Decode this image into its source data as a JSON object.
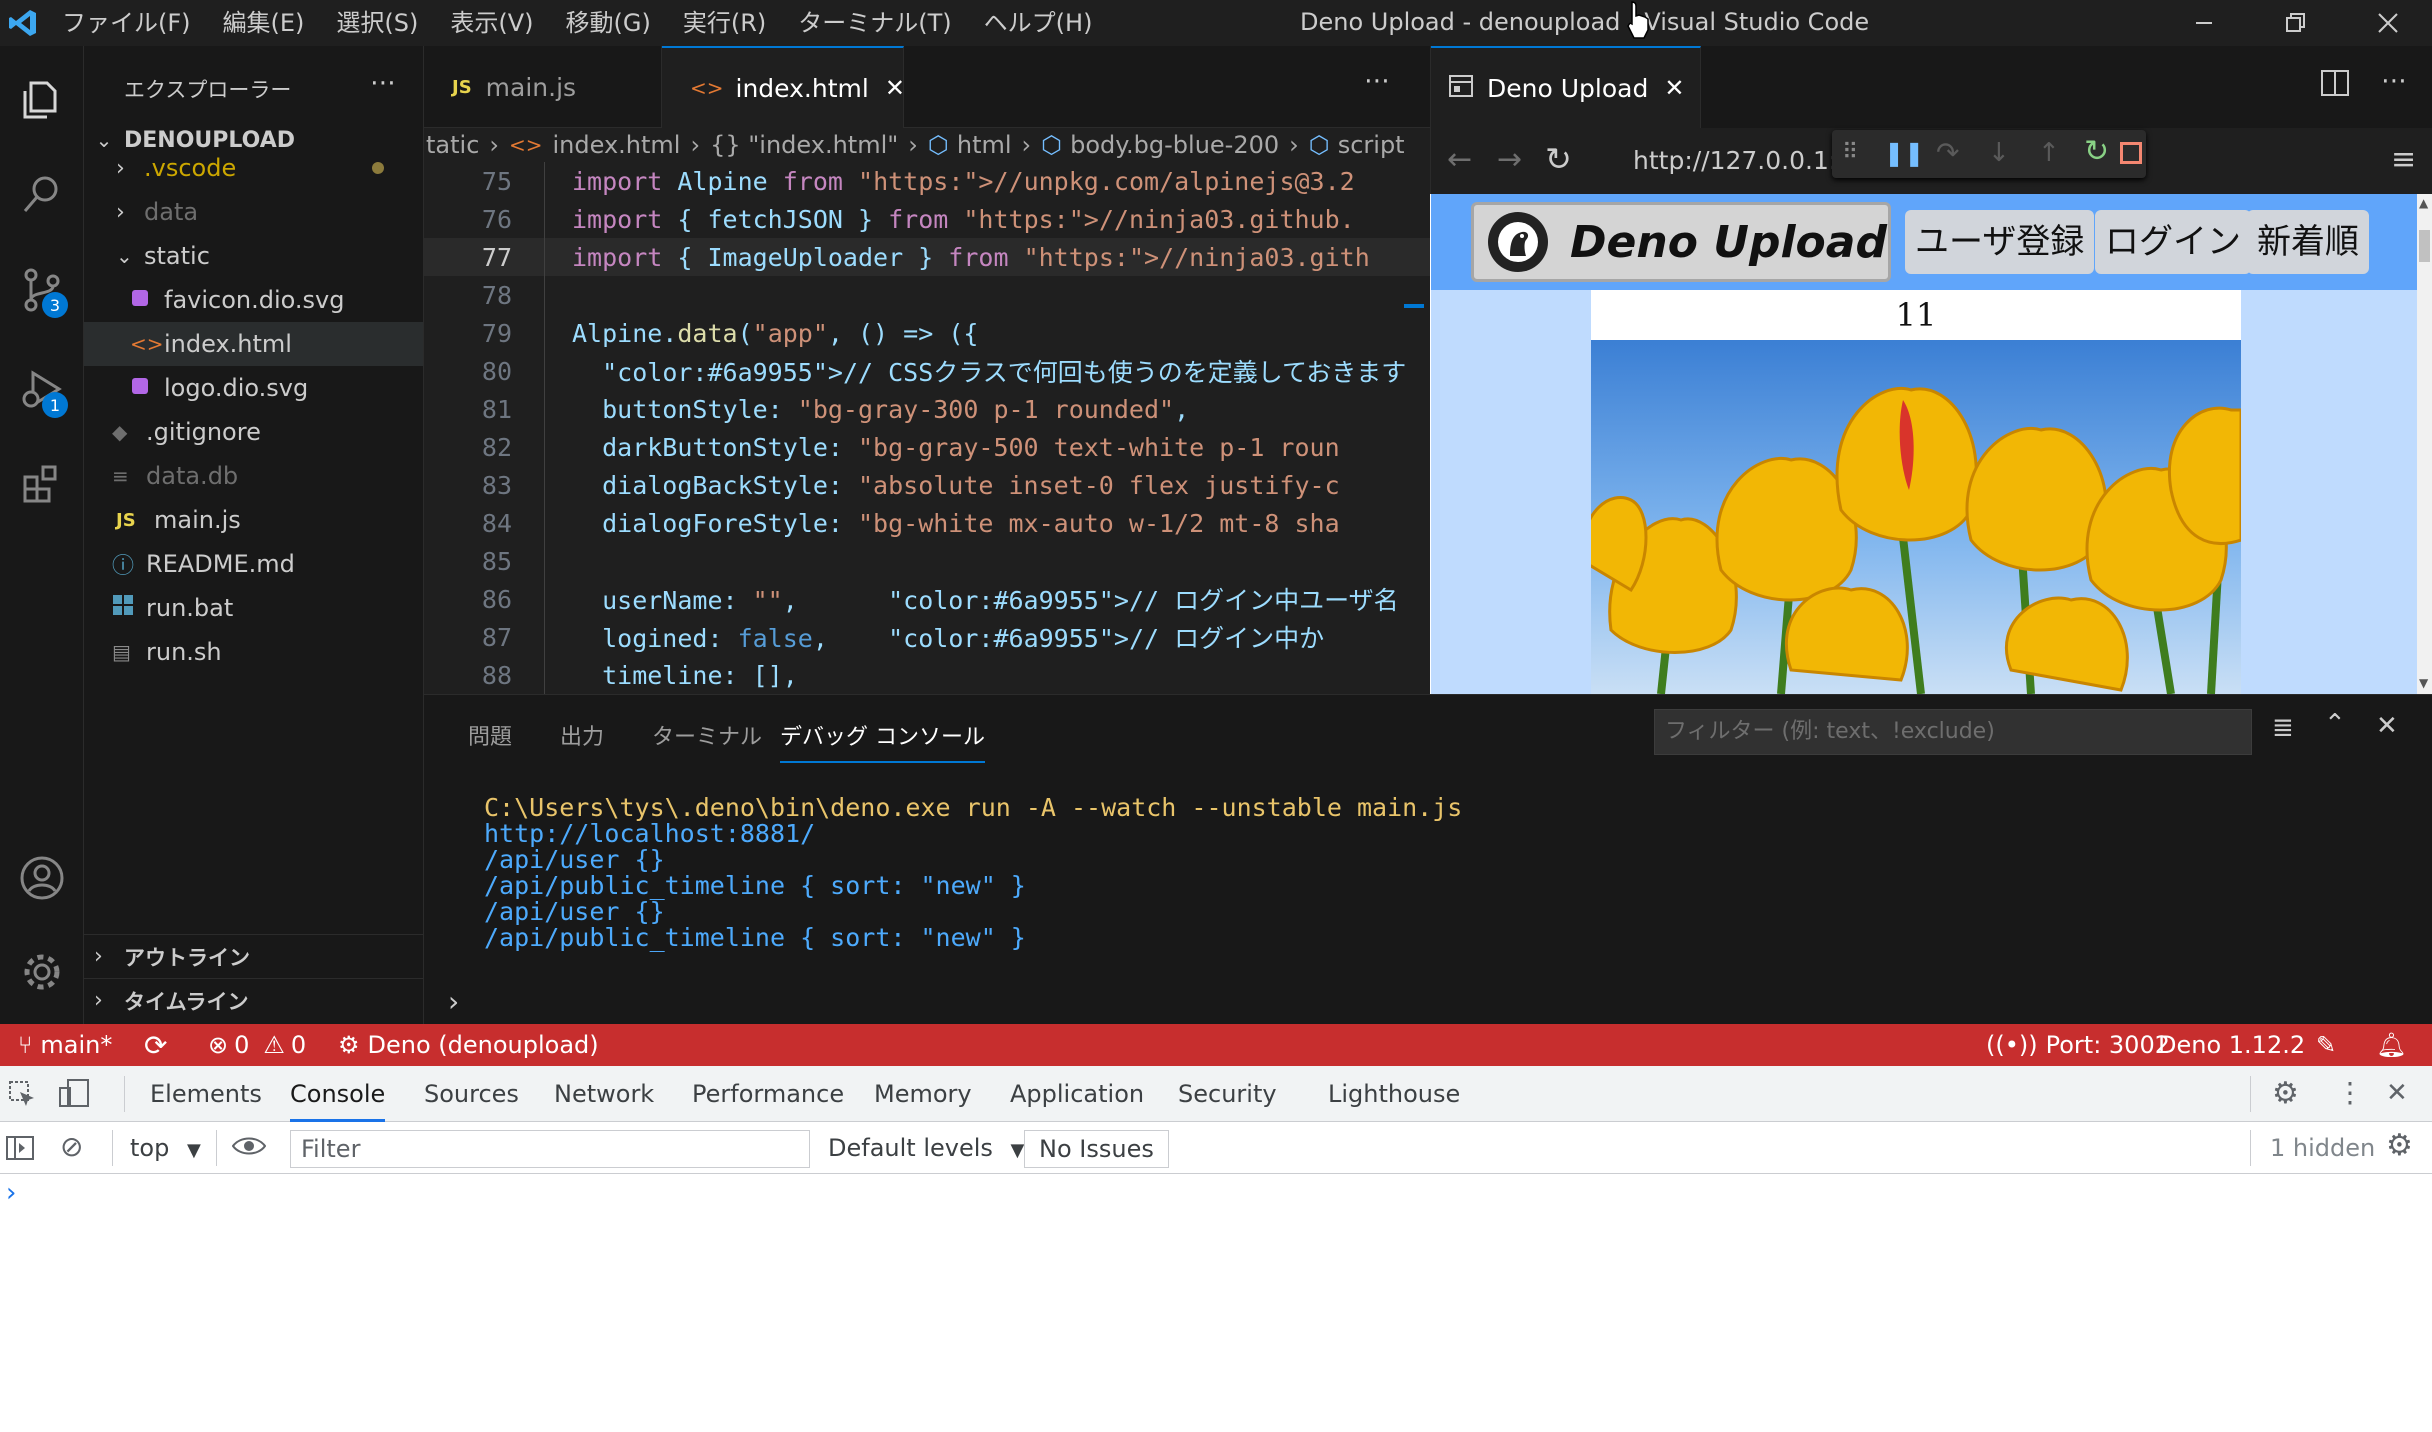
{
  "titlebar": {
    "menu": [
      "ファイル(F)",
      "編集(E)",
      "選択(S)",
      "表示(V)",
      "移動(G)",
      "実行(R)",
      "ターミナル(T)",
      "ヘルプ(H)"
    ],
    "title": "Deno Upload - denoupload - Visual Studio Code"
  },
  "activity_bar": {
    "scm_badge": "3",
    "debug_badge": "1"
  },
  "sidebar": {
    "header": "エクスプローラー",
    "project": "DENOUPLOAD",
    "items": [
      {
        "label": ".vscode",
        "kind": "folder"
      },
      {
        "label": "data",
        "kind": "folder"
      },
      {
        "label": "static",
        "kind": "folder-open"
      },
      {
        "label": "favicon.dio.svg",
        "kind": "svg"
      },
      {
        "label": "index.html",
        "kind": "html"
      },
      {
        "label": "logo.dio.svg",
        "kind": "svg"
      },
      {
        "label": ".gitignore",
        "kind": "git"
      },
      {
        "label": "data.db",
        "kind": "db"
      },
      {
        "label": "main.js",
        "kind": "js"
      },
      {
        "label": "README.md",
        "kind": "info"
      },
      {
        "label": "run.bat",
        "kind": "windows"
      },
      {
        "label": "run.sh",
        "kind": "sh"
      }
    ],
    "outline": "アウトライン",
    "timeline": "タイムライン"
  },
  "editor": {
    "tabs": [
      {
        "label": "main.js",
        "icon": "JS"
      },
      {
        "label": "index.html",
        "icon": "<>"
      }
    ],
    "breadcrumb": [
      "tatic",
      "index.html",
      "{} \"index.html\"",
      "html",
      "body.bg-blue-200",
      "script"
    ],
    "lines": [
      {
        "no": "75",
        "text": "import Alpine from \"https://unpkg.com/alpinejs@3.2"
      },
      {
        "no": "76",
        "text": "import { fetchJSON } from \"https://ninja03.github."
      },
      {
        "no": "77",
        "text": "import { ImageUploader } from \"https://ninja03.gith"
      },
      {
        "no": "78",
        "text": ""
      },
      {
        "no": "79",
        "text": "Alpine.data(\"app\", () => ({"
      },
      {
        "no": "80",
        "text": "  // CSSクラスで何回も使うのを定義しておきます"
      },
      {
        "no": "81",
        "text": "  buttonStyle: \"bg-gray-300 p-1 rounded\","
      },
      {
        "no": "82",
        "text": "  darkButtonStyle: \"bg-gray-500 text-white p-1 roun"
      },
      {
        "no": "83",
        "text": "  dialogBackStyle: \"absolute inset-0 flex justify-c"
      },
      {
        "no": "84",
        "text": "  dialogForeStyle: \"bg-white mx-auto w-1/2 mt-8 sha"
      },
      {
        "no": "85",
        "text": ""
      },
      {
        "no": "86",
        "text": "  userName: \"\",      // ログイン中ユーザ名"
      },
      {
        "no": "87",
        "text": "  logined: false,    // ログイン中か"
      },
      {
        "no": "88",
        "text": "  timeline: [],"
      }
    ]
  },
  "browser": {
    "tab": "Deno Upload",
    "url": "http://127.0.0.1:3",
    "app_title": "Deno Upload",
    "buttons": [
      "ユーザ登録",
      "ログイン",
      "新着順"
    ],
    "post_number": "11"
  },
  "panel": {
    "tabs": [
      "問題",
      "出力",
      "ターミナル",
      "デバッグ コンソール"
    ],
    "filter_placeholder": "フィルター (例: text、!exclude)",
    "lines": [
      "C:\\Users\\tys\\.deno\\bin\\deno.exe run -A --watch --unstable main.js",
      "http://localhost:8881/",
      "/api/user {}",
      "/api/public_timeline { sort: \"new\" }",
      "/api/user {}",
      "/api/public_timeline { sort: \"new\" }"
    ]
  },
  "statusbar": {
    "branch": "main*",
    "errors": "0",
    "warnings": "0",
    "debug": "Deno (denoupload)",
    "port": "Port: 3002",
    "deno": "Deno 1.12.2"
  },
  "devtools": {
    "tabs": [
      "Elements",
      "Console",
      "Sources",
      "Network",
      "Performance",
      "Memory",
      "Application",
      "Security",
      "Lighthouse"
    ],
    "context": "top",
    "filter_placeholder": "Filter",
    "levels": "Default levels",
    "issues": "No Issues",
    "hidden": "1 hidden"
  },
  "colors": {
    "statusbar": "#c72e2e",
    "accent": "#0078d4",
    "keyword": "#c586c0",
    "string": "#ce9178",
    "comment": "#6a9955"
  }
}
